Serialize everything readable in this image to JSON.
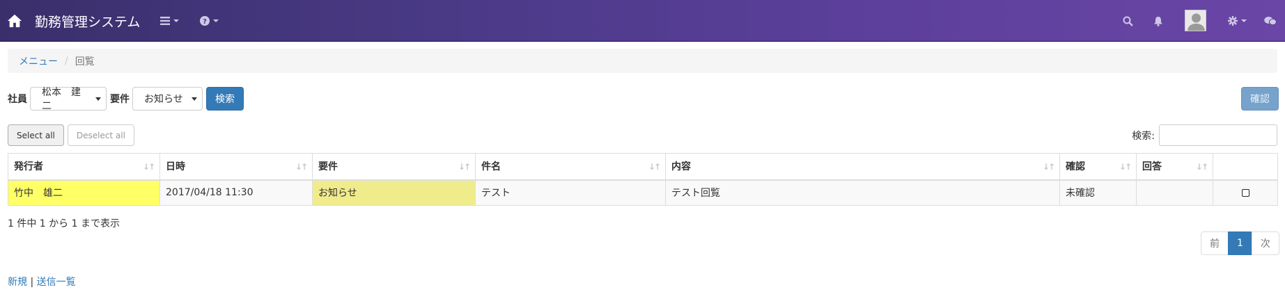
{
  "navbar": {
    "brand": "勤務管理システム",
    "icons": [
      "home-icon",
      "list-menu-icon",
      "help-icon",
      "search-icon",
      "bell-icon",
      "avatar",
      "gear-icon",
      "chat-icon"
    ]
  },
  "breadcrumb": {
    "menu": "メニュー",
    "current": "回覧"
  },
  "filter": {
    "employee_label": "社員",
    "employee_value": "松本　建二",
    "item_label": "要件",
    "item_value": "お知らせ",
    "search_button": "検索",
    "confirm_button": "確認"
  },
  "selection": {
    "select_all": "Select all",
    "deselect_all": "Deselect all"
  },
  "search": {
    "label": "検索:",
    "value": ""
  },
  "table": {
    "headers": [
      "発行者",
      "日時",
      "要件",
      "件名",
      "内容",
      "確認",
      "回答",
      ""
    ],
    "rows": [
      {
        "issuer": "竹中　雄二",
        "datetime": "2017/04/18 11:30",
        "item": "お知らせ",
        "subject": "テスト",
        "content": "テスト回覧",
        "confirm": "未確認",
        "answer": "",
        "checked": false
      }
    ]
  },
  "info": "1 件中 1 から 1 まで表示",
  "pager": {
    "prev": "前",
    "current": "1",
    "next": "次"
  },
  "footer": {
    "new_link": "新規",
    "separator": "|",
    "sent_list_link": "送信一覧"
  },
  "colors": {
    "navbar_start": "#3a2f6b",
    "navbar_end": "#6a46a6",
    "primary": "#337ab7",
    "highlight_yellow": "#ffff66",
    "highlight_khaki": "#f0ec8c"
  }
}
